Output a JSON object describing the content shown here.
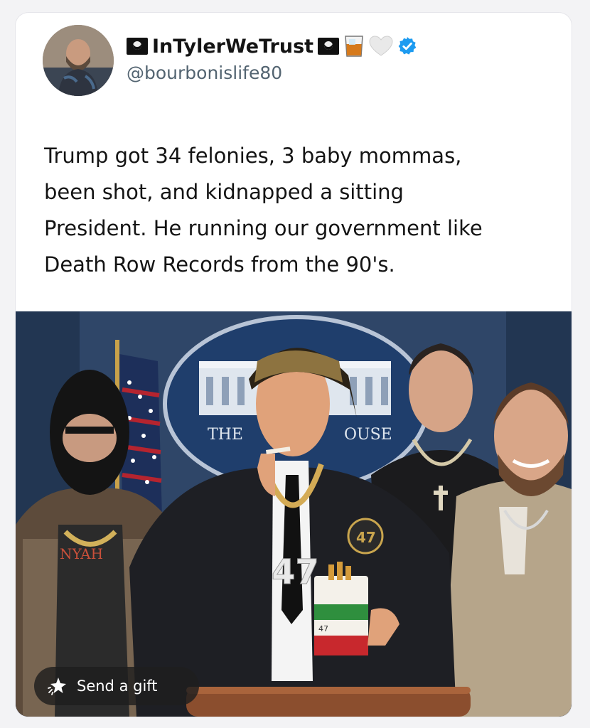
{
  "post": {
    "display_name": "InTylerWeTrust",
    "handle": "@bourbonislife80",
    "text": "Trump got 34 felonies, 3 baby mommas,\nbeen shot, and kidnapped a sitting\nPresident. He running our government like\nDeath Row Records from the 90's.",
    "verified": true,
    "name_icons": [
      "pirate-flag-icon",
      "pirate-flag-icon",
      "whiskey-glass-icon",
      "white-heart-icon",
      "verified-badge-icon"
    ]
  },
  "media": {
    "sign_text_left": "THE",
    "sign_text_right": "OUSE",
    "jersey_number": "47",
    "patch_number": "47",
    "pack_number": "47",
    "shirt_text": "NYAH"
  },
  "actions": {
    "gift_label": "Send a gift"
  },
  "colors": {
    "verified_blue": "#1d9bf0",
    "handle_gray": "#536471",
    "text": "#141414"
  }
}
